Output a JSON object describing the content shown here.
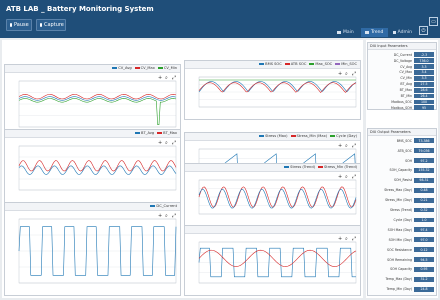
{
  "header": {
    "title": "ATB LAB _ Battery Monitoring System",
    "pause_label": "Pause",
    "capture_label": "Capture",
    "tabs": [
      {
        "label": "Main",
        "active": false
      },
      {
        "label": "Trend",
        "active": true
      },
      {
        "label": "Admin",
        "active": false
      }
    ]
  },
  "panels": [
    {
      "key": "cv",
      "legend": [
        {
          "name": "CV_Avg",
          "color": "#1f77b4"
        },
        {
          "name": "CV_Max",
          "color": "#d62728"
        },
        {
          "name": "CV_Min",
          "color": "#2ca02c"
        }
      ]
    },
    {
      "key": "bt",
      "legend": [
        {
          "name": "BT_Avg",
          "color": "#1f77b4"
        },
        {
          "name": "BT_Max",
          "color": "#d62728"
        }
      ]
    },
    {
      "key": "current",
      "legend": [
        {
          "name": "DC_Current",
          "color": "#1f77b4"
        }
      ]
    },
    {
      "key": "soc",
      "legend": [
        {
          "name": "BMS SOC",
          "color": "#1f77b4"
        },
        {
          "name": "ATB SOC",
          "color": "#d62728"
        },
        {
          "name": "Max_SOC",
          "color": "#2ca02c"
        },
        {
          "name": "Min_SOC",
          "color": "#9467bd"
        }
      ]
    },
    {
      "key": "stress",
      "legend": [
        {
          "name": "Stress (Max)",
          "color": "#1f77b4"
        },
        {
          "name": "Stress_Min (Max)",
          "color": "#d62728"
        },
        {
          "name": "Cycle (Day)",
          "color": "#2ca02c"
        }
      ]
    },
    {
      "key": "stress2",
      "legend": [
        {
          "name": "Stress (Trend)",
          "color": "#1f77b4"
        },
        {
          "name": "Stress_Min (Trend)",
          "color": "#d62728"
        }
      ]
    },
    {
      "key": "trend4",
      "legend": []
    }
  ],
  "sidebar": {
    "input_title": "DIU Input Parameters",
    "input_rows": [
      {
        "label": "DC_Current",
        "value": "-2.3"
      },
      {
        "label": "DC_Voltage",
        "value": "736.0"
      },
      {
        "label": "CV_Avg",
        "value": "3.3"
      },
      {
        "label": "CV_Max",
        "value": "3.4"
      },
      {
        "label": "CV_Min",
        "value": "3.3"
      },
      {
        "label": "BT_Avg",
        "value": "27.5"
      },
      {
        "label": "BT_Max",
        "value": "28.6"
      },
      {
        "label": "BT_Min",
        "value": "26.4"
      },
      {
        "label": "Modbus_SOC",
        "value": "100"
      },
      {
        "label": "Modbus_SOH",
        "value": "95"
      }
    ],
    "output_title": "DIU Output Parameters",
    "output_rows": [
      {
        "label": "BMS_SOC",
        "value": "73.386"
      },
      {
        "label": "ATB_SOC",
        "value": "79.036"
      },
      {
        "label": "SOH",
        "value": "97.2"
      },
      {
        "label": "SOH_Capacity",
        "value": "155.32"
      },
      {
        "label": "SOH_Resist",
        "value": "98.31"
      },
      {
        "label": "Stress_Max (Day)",
        "value": "0.48"
      },
      {
        "label": "Stress_Min (Day)",
        "value": "0.21"
      },
      {
        "label": "Stress (Trend)",
        "value": "0.32"
      },
      {
        "label": "Cycle (Day)",
        "value": "1.0"
      },
      {
        "label": "SOH Max (Day)",
        "value": "97.4"
      },
      {
        "label": "SOH Min (Day)",
        "value": "97.0"
      },
      {
        "label": "SOC Resistance",
        "value": "0.12"
      },
      {
        "label": "SOH Remaining",
        "value": "94.5"
      },
      {
        "label": "SOH Capacity",
        "value": "0.95"
      },
      {
        "label": "Temp_Max (Day)",
        "value": "31.2"
      },
      {
        "label": "Temp_Min (Day)",
        "value": "24.8"
      }
    ]
  },
  "colors": {
    "header": "#1f4e79",
    "accent": "#2f6aa5",
    "value_box": "#3b6a98"
  }
}
